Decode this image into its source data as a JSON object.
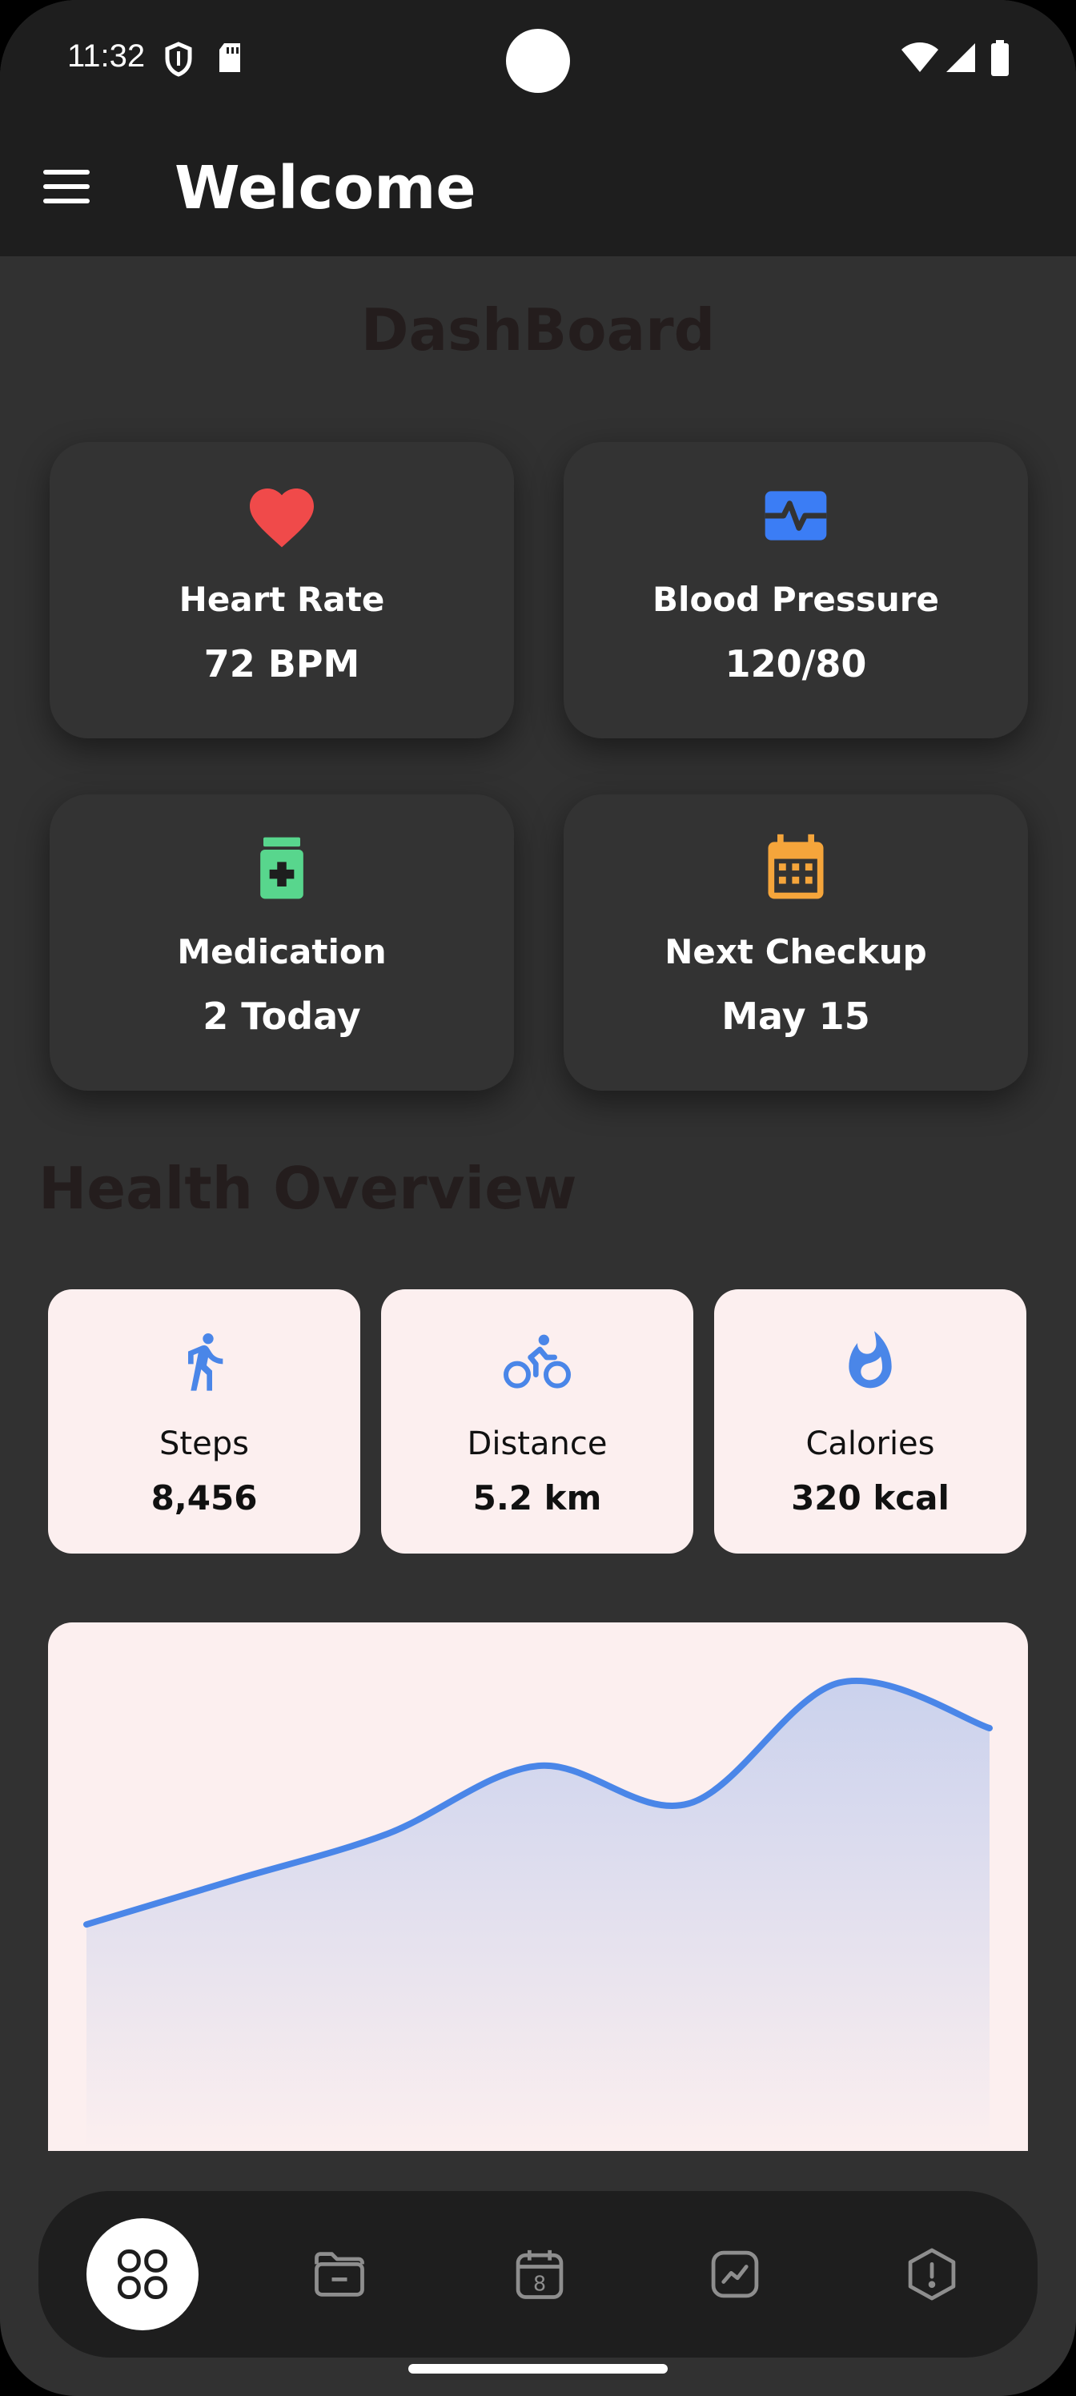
{
  "status": {
    "time": "11:32"
  },
  "appbar": {
    "title": "Welcome"
  },
  "dashboard": {
    "title": "DashBoard",
    "cards": [
      {
        "label": "Heart Rate",
        "value": "72 BPM",
        "icon": "heart-icon",
        "color": "#f04a4a"
      },
      {
        "label": "Blood Pressure",
        "value": "120/80",
        "icon": "monitor-heart-icon",
        "color": "#3b7df5"
      },
      {
        "label": "Medication",
        "value": "2 Today",
        "icon": "medication-icon",
        "color": "#58d68d"
      },
      {
        "label": "Next Checkup",
        "value": "May 15",
        "icon": "calendar-icon",
        "color": "#f5a53b"
      }
    ]
  },
  "overview": {
    "title": "Health Overview",
    "items": [
      {
        "label": "Steps",
        "value": "8,456",
        "icon": "walk-icon"
      },
      {
        "label": "Distance",
        "value": "5.2 km",
        "icon": "bike-icon"
      },
      {
        "label": "Calories",
        "value": "320 kcal",
        "icon": "flame-icon"
      }
    ],
    "accent": "#4a86e8"
  },
  "chart_data": {
    "type": "area",
    "x": [
      0,
      1,
      2,
      3,
      4,
      5,
      6
    ],
    "values": [
      3.0,
      3.6,
      4.2,
      5.1,
      4.6,
      6.2,
      5.6
    ],
    "ylim": [
      0,
      7
    ],
    "color": "#4a86e8"
  },
  "nav": {
    "items": [
      {
        "name": "dashboard",
        "icon": "grid-icon",
        "active": true
      },
      {
        "name": "records",
        "icon": "folder-icon",
        "active": false
      },
      {
        "name": "calendar",
        "icon": "calendar-8-icon",
        "active": false
      },
      {
        "name": "analytics",
        "icon": "chart-icon",
        "active": false
      },
      {
        "name": "alerts",
        "icon": "alert-icon",
        "active": false
      }
    ]
  }
}
